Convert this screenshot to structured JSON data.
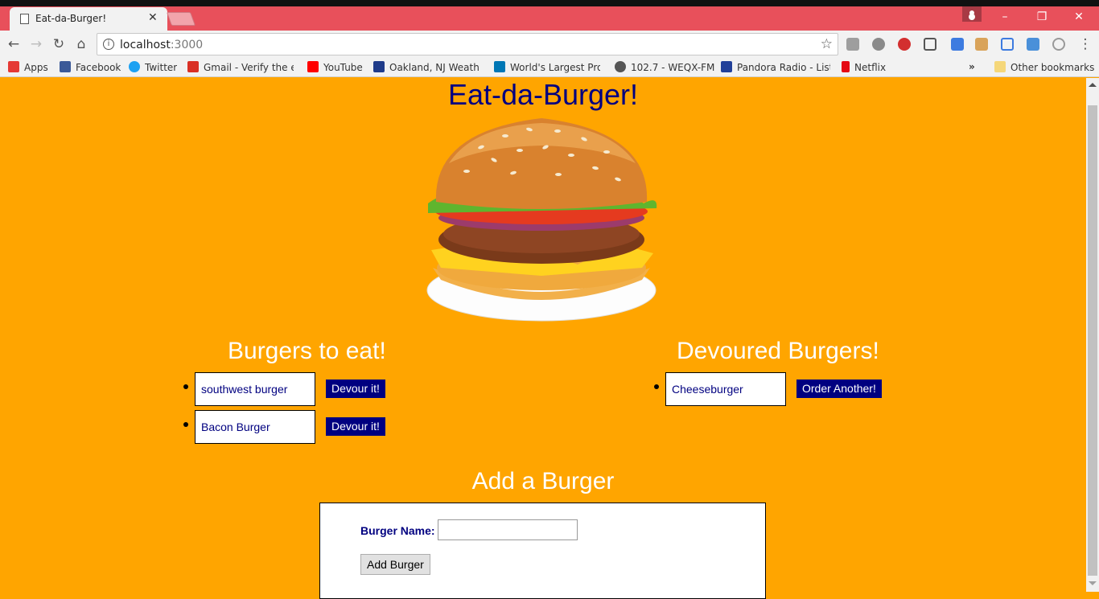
{
  "browser": {
    "tab_title": "Eat-da-Burger!",
    "tab_close": "✕",
    "url_host": "localhost",
    "url_port": ":3000",
    "window_buttons": [
      "–",
      "❐",
      "✕"
    ],
    "bookmarks": [
      {
        "label": "Apps",
        "icon": "apps-grid-icon",
        "color": "#e53935"
      },
      {
        "label": "Facebook",
        "icon": "facebook-icon",
        "color": "#3b5998"
      },
      {
        "label": "Twitter",
        "icon": "twitter-icon",
        "color": "#1da1f2"
      },
      {
        "label": "Gmail - Verify the em",
        "icon": "gmail-icon",
        "color": "#d93025"
      },
      {
        "label": "YouTube",
        "icon": "youtube-icon",
        "color": "#ff0000"
      },
      {
        "label": "Oakland, NJ Weather",
        "icon": "weather-channel-icon",
        "color": "#1f3b8a"
      },
      {
        "label": "World's Largest Profe",
        "icon": "linkedin-icon",
        "color": "#0077b5"
      },
      {
        "label": "102.7 - WEQX-FM",
        "icon": "radio-icon",
        "color": "#555555"
      },
      {
        "label": "Pandora Radio - Liste",
        "icon": "pandora-icon",
        "color": "#224099"
      },
      {
        "label": "Netflix",
        "icon": "netflix-icon",
        "color": "#e50914"
      }
    ],
    "bookmarks_overflow": "»",
    "other_bookmarks": "Other bookmarks"
  },
  "page": {
    "title": "Eat-da-Burger!",
    "to_eat_heading": "Burgers to eat!",
    "devoured_heading": "Devoured Burgers!",
    "to_eat": [
      {
        "name": "southwest burger",
        "button": "Devour it!"
      },
      {
        "name": "Bacon Burger",
        "button": "Devour it!"
      }
    ],
    "devoured": [
      {
        "name": "Cheeseburger",
        "button": "Order Another!"
      }
    ],
    "add_heading": "Add a Burger",
    "form": {
      "label": "Burger Name:",
      "input_value": "",
      "submit": "Add Burger"
    }
  },
  "colors": {
    "page_background": "#ffa500",
    "heading_navy": "#000080",
    "button_navy": "#000080",
    "titlebar": "#e8505b"
  }
}
